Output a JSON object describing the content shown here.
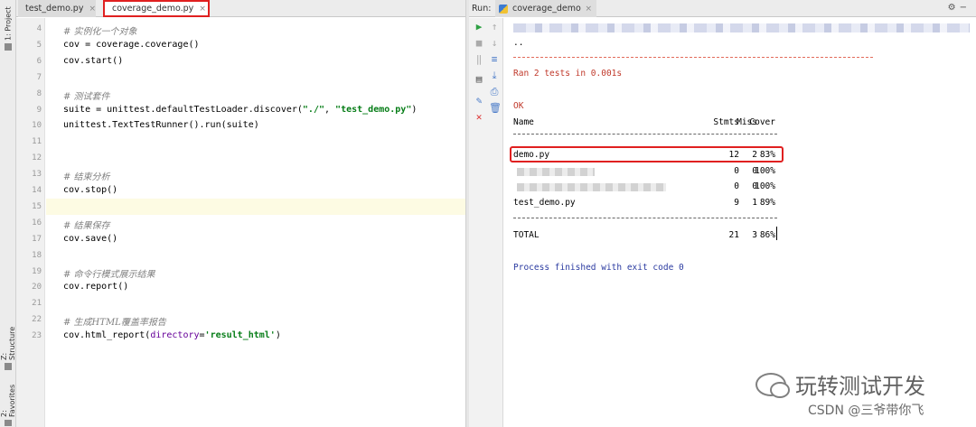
{
  "sidebar": {
    "project": "1: Project",
    "structure": "Z: Structure",
    "favorites": "2: Favorites"
  },
  "editor": {
    "tabs": [
      {
        "label": "test_demo.py"
      },
      {
        "label": "coverage_demo.py"
      }
    ],
    "lines": [
      {
        "n": "4",
        "text": "# 实例化一个对象"
      },
      {
        "n": "5",
        "text": "cov = coverage.coverage()"
      },
      {
        "n": "6",
        "text": "cov.start()"
      },
      {
        "n": "7",
        "text": ""
      },
      {
        "n": "8",
        "text": "# 测试套件"
      },
      {
        "n": "9",
        "pre": "suite = unittest.defaultTestLoader.discover(",
        "s1": "\"./\"",
        "mid": ", ",
        "s2": "\"test_demo.py\"",
        "post": ")"
      },
      {
        "n": "10",
        "text": "unittest.TextTestRunner().run(suite)"
      },
      {
        "n": "11",
        "text": ""
      },
      {
        "n": "12",
        "text": ""
      },
      {
        "n": "13",
        "text": "# 结束分析"
      },
      {
        "n": "14",
        "text": "cov.stop()"
      },
      {
        "n": "15",
        "text": ""
      },
      {
        "n": "16",
        "text": "# 结果保存"
      },
      {
        "n": "17",
        "text": "cov.save()"
      },
      {
        "n": "18",
        "text": ""
      },
      {
        "n": "19",
        "text": "# 命令行模式展示结果"
      },
      {
        "n": "20",
        "text": "cov.report()"
      },
      {
        "n": "21",
        "text": ""
      },
      {
        "n": "22",
        "text": "# 生成HTML覆盖率报告"
      },
      {
        "n": "23",
        "pre": "cov.html_report(",
        "kw": "directory",
        "eq": "=",
        "s1": "'result_html'",
        "post": ")"
      }
    ]
  },
  "run": {
    "label": "Run:",
    "tab": "coverage_demo",
    "console": {
      "dots": "..",
      "ran": "Ran 2 tests in 0.001s",
      "ok": "OK",
      "headers": [
        "Name",
        "Stmts",
        "Miss",
        "Cover"
      ],
      "rows": [
        {
          "name": "demo.py",
          "stmts": "12",
          "miss": "2",
          "cover": "83%"
        },
        {
          "name": "",
          "stmts": "0",
          "miss": "0",
          "cover": "100%"
        },
        {
          "name": "",
          "stmts": "0",
          "miss": "0",
          "cover": "100%"
        },
        {
          "name": "test_demo.py",
          "stmts": "9",
          "miss": "1",
          "cover": "89%"
        }
      ],
      "total": {
        "name": "TOTAL",
        "stmts": "21",
        "miss": "3",
        "cover": "86%"
      },
      "finished": "Process finished with exit code 0"
    }
  },
  "watermark": {
    "title": "玩转测试开发",
    "credit": "CSDN @三爷带你飞"
  },
  "colors": {
    "highlight_box": "#e02020",
    "ok_text": "#c0392b",
    "process_text": "#2a3aa0",
    "string": "#067d17",
    "comment": "#808080"
  }
}
